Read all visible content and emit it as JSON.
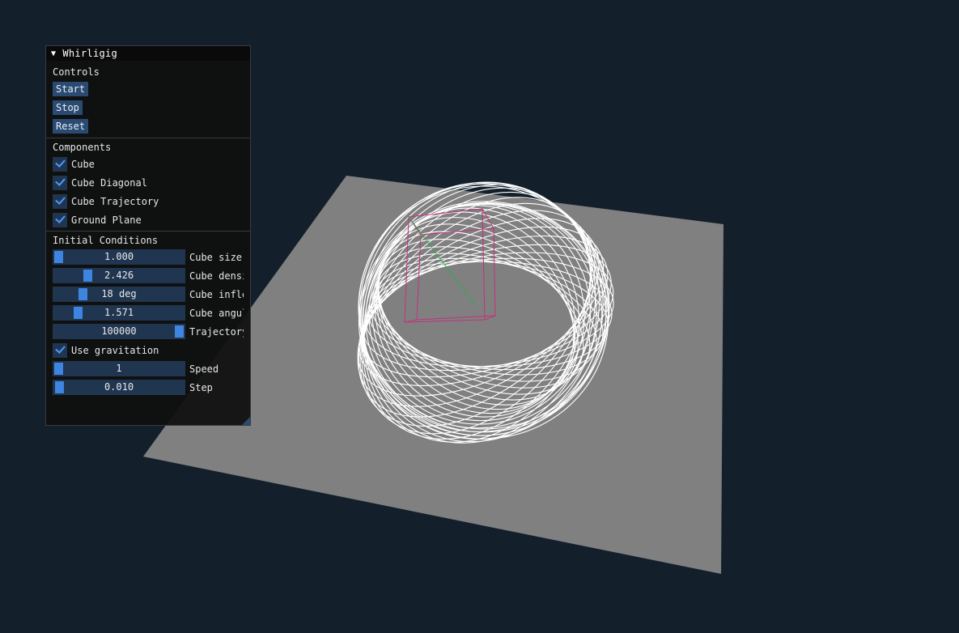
{
  "window": {
    "title": "Whirligig"
  },
  "controls": {
    "heading": "Controls",
    "start_label": "Start",
    "stop_label": "Stop",
    "reset_label": "Reset"
  },
  "components": {
    "heading": "Components",
    "items": [
      {
        "label": "Cube",
        "checked": true
      },
      {
        "label": "Cube Diagonal",
        "checked": true
      },
      {
        "label": "Cube Trajectory",
        "checked": true
      },
      {
        "label": "Ground Plane",
        "checked": true
      }
    ]
  },
  "initial_conditions": {
    "heading": "Initial Conditions",
    "sliders": [
      {
        "value": "1.000",
        "label": "Cube size",
        "fraction": 0.0
      },
      {
        "value": "2.426",
        "label": "Cube density",
        "fraction": 0.24
      },
      {
        "value": "18 deg",
        "label": "Cube inflection",
        "fraction": 0.2
      },
      {
        "value": "1.571",
        "label": "Cube angular velocity",
        "fraction": 0.16
      },
      {
        "value": "100000",
        "label": "Trajectory",
        "fraction": 1.0
      }
    ],
    "gravitation": {
      "label": "Use gravitation",
      "checked": true
    },
    "speed": {
      "value": "1",
      "label": "Speed",
      "fraction": 0.0
    },
    "step": {
      "value": "0.010",
      "label": "Step",
      "fraction": 0.01
    }
  },
  "colors": {
    "background": "#13202c",
    "ground_plane": "#808080",
    "trajectory": "#ffffff",
    "cube": "#c2327a",
    "diagonal": "#22b14c",
    "accent": "#3d85e0"
  }
}
